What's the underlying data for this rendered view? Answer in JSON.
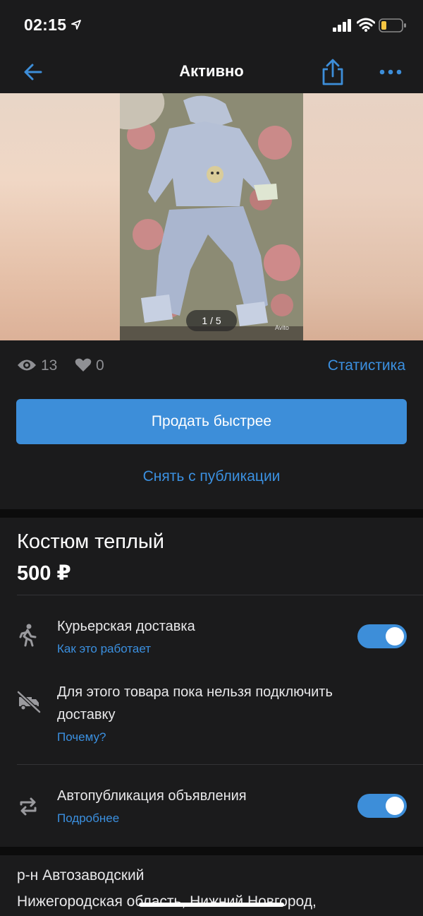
{
  "status_bar": {
    "time": "02:15"
  },
  "nav": {
    "title": "Активно"
  },
  "gallery": {
    "counter": "1 / 5",
    "watermark": "Avito"
  },
  "stats": {
    "views": "13",
    "likes": "0",
    "link": "Статистика"
  },
  "actions": {
    "sell_faster": "Продать быстрее",
    "unpublish": "Снять с публикации"
  },
  "item": {
    "title": "Костюм теплый",
    "price": "500 ₽"
  },
  "options": [
    {
      "title": "Курьерская доставка",
      "link": "Как это работает",
      "toggle_on": true,
      "icon": "courier-icon"
    },
    {
      "title_line1": "Для этого товара пока нельзя подключить",
      "title_line2": "доставку",
      "link": "Почему?",
      "icon": "no-delivery-truck-icon"
    },
    {
      "title": "Автопубликация объявления",
      "link": "Подробнее",
      "toggle_on": true,
      "icon": "auto-publish-icon"
    }
  ],
  "address": {
    "line1": "р-н Автозаводский",
    "line2": "Нижегородская область, Нижний Новгород,"
  },
  "colors": {
    "accent": "#3d8ed9",
    "link": "#3b90e0",
    "background": "#1b1b1c"
  }
}
